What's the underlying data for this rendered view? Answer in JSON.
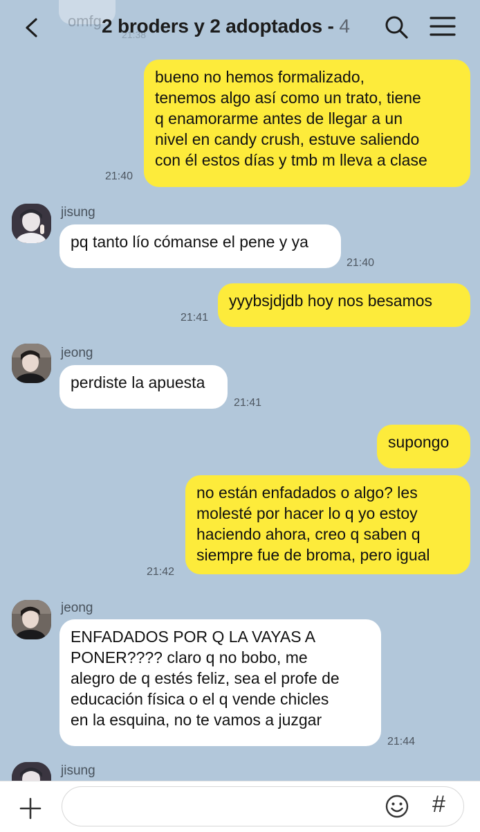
{
  "header": {
    "ghost_text": "omfg",
    "ghost_time": "21:38",
    "title": "2 broders y 2 adoptados - ",
    "member_count": "4"
  },
  "messages": [
    {
      "side": "out",
      "text": "bueno no hemos formalizado,\ntenemos algo así como un trato, tiene\nq enamorarme antes de llegar a un\nnivel en candy crush, estuve saliendo\ncon él estos días y tmb m lleva a clase",
      "time": "21:40"
    },
    {
      "side": "in",
      "sender": "jisung",
      "text": "pq tanto lío cómanse el pene y ya",
      "time": "21:40"
    },
    {
      "side": "out",
      "text": "yyybsjdjdb hoy nos besamos",
      "time": "21:41"
    },
    {
      "side": "in",
      "sender": "jeong",
      "text": "perdiste la apuesta",
      "time": "21:41"
    },
    {
      "side": "out",
      "text": "supongo",
      "time": ""
    },
    {
      "side": "out",
      "text": "no están enfadados o algo? les\nmolesté por hacer lo q yo estoy\nhaciendo ahora, creo q saben q\nsiempre fue de broma, pero igual",
      "time": "21:42"
    },
    {
      "side": "in",
      "sender": "jeong",
      "text": "ENFADADOS POR Q LA VAYAS A\nPONER???? claro q no bobo, me\nalegro de q estés feliz, sea el profe de\neducación física o el q vende chicles\nen la esquina, no te vamos a juzgar",
      "time": "21:44"
    },
    {
      "side": "in",
      "sender": "jisung",
      "text": "",
      "time": ""
    }
  ],
  "footer": {
    "input_placeholder": "",
    "hash_label": "#"
  },
  "colors": {
    "background": "#b2c7da",
    "outgoing_bubble": "#fdeb3b",
    "incoming_bubble": "#ffffff"
  },
  "icons": [
    "back-arrow-icon",
    "search-icon",
    "menu-icon",
    "plus-icon",
    "emoji-icon",
    "hash-icon"
  ]
}
